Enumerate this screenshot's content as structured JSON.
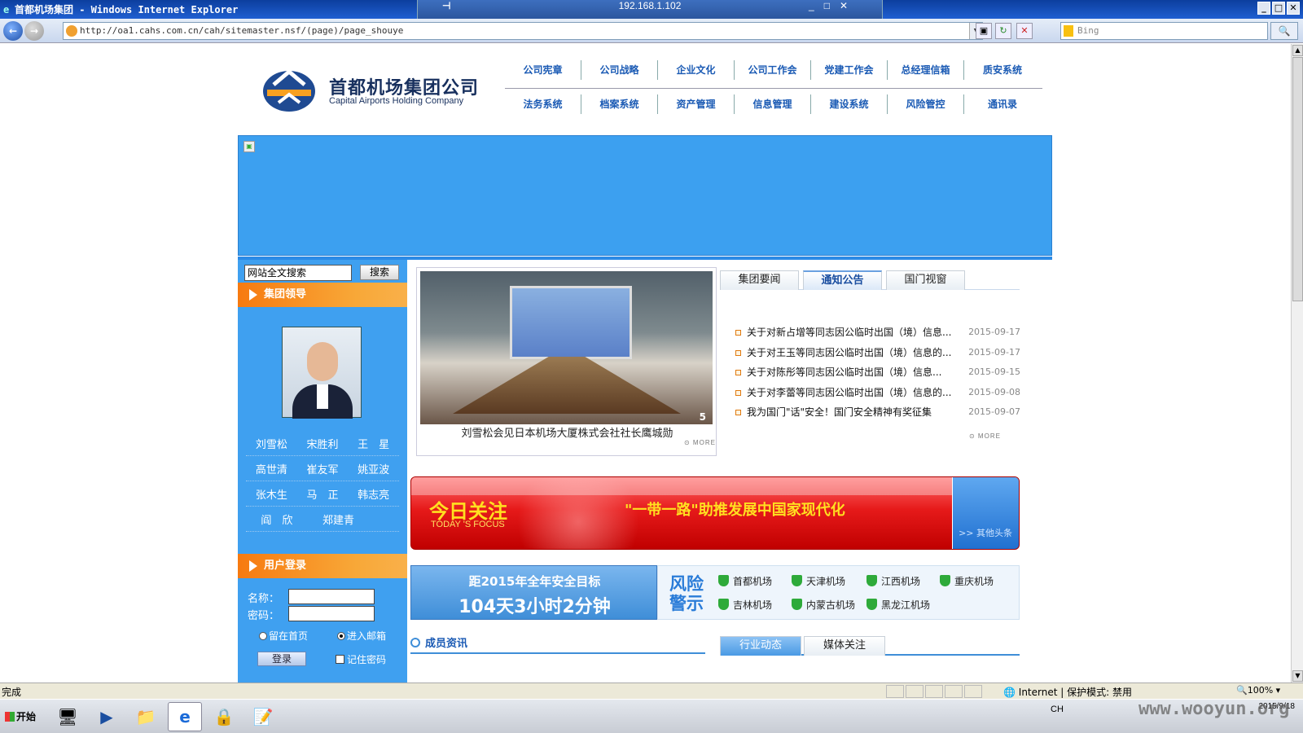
{
  "window": {
    "title": "首都机场集团 - Windows Internet Explorer",
    "rdp_host": "192.168.1.102",
    "min": "_",
    "max": "□",
    "close": "✕"
  },
  "browser": {
    "back": "←",
    "forward": "→",
    "address": "http://oa1.cahs.com.cn/cah/sitemaster.nsf/(page)/page_shouye",
    "search_placeholder": "Bing",
    "search_btn": "🔍",
    "refresh": "↻",
    "stop": "✕",
    "compat": "▣"
  },
  "site": {
    "logo_cn": "首都机场集团公司",
    "logo_en": "Capital Airports Holding Company",
    "nav_row1": [
      "公司宪章",
      "公司战略",
      "企业文化",
      "公司工作会",
      "党建工作会",
      "总经理信箱",
      "质安系统"
    ],
    "nav_row2": [
      "法务系统",
      "档案系统",
      "资产管理",
      "信息管理",
      "建设系统",
      "风险管控",
      "通讯录"
    ]
  },
  "left": {
    "search_placeholder": "网站全文搜索",
    "search_btn": "搜索",
    "leaders_title": "集团领导",
    "leaders": [
      [
        "刘雪松",
        "宋胜利",
        "王　星"
      ],
      [
        "高世清",
        "崔友军",
        "姚亚波"
      ],
      [
        "张木生",
        "马　正",
        "韩志亮"
      ],
      [
        "阎　欣",
        "郑建青",
        ""
      ]
    ],
    "login_title": "用户登录",
    "name_label": "名称：",
    "pwd_label": "密码：",
    "radio1": "留在首页",
    "radio2": "进入邮箱",
    "login_btn": "登录",
    "remember": "记住密码"
  },
  "photo": {
    "caption": "刘雪松会见日本机场大厦株式会社社长鹰城勋",
    "slide_num": "5",
    "more": "⊙ MORE"
  },
  "news": {
    "tabs": [
      "集团要闻",
      "通知公告",
      "国门视窗"
    ],
    "active_tab": "通知公告",
    "items": [
      {
        "title": "关于对新占增等同志因公临时出国（境）信息...",
        "date": "2015-09-17"
      },
      {
        "title": "关于对王玉等同志因公临时出国（境）信息的...",
        "date": "2015-09-17"
      },
      {
        "title": "关于对陈彤等同志因公临时出国（境）信息...",
        "date": "2015-09-15"
      },
      {
        "title": "关于对李蕾等同志因公临时出国（境）信息的...",
        "date": "2015-09-08"
      },
      {
        "title": "我为国门\"话\"安全！国门安全精神有奖征集",
        "date": "2015-09-07"
      }
    ],
    "more": "⊙ MORE"
  },
  "focus": {
    "title": "今日关注",
    "subtitle": "TODAY 'S FOCUS",
    "headline": "\"一带一路\"助推发展中国家现代化",
    "other": ">> 其他头条"
  },
  "countdown": {
    "line1": "距2015年全年安全目标",
    "line2": "104天3小时2分钟"
  },
  "risk": {
    "title": "风险警示",
    "airports": [
      "首都机场",
      "天津机场",
      "江西机场",
      "重庆机场",
      "吉林机场",
      "内蒙古机场",
      "黑龙江机场"
    ]
  },
  "bottom": {
    "member_title": "成员资讯",
    "tabs": [
      "行业动态",
      "媒体关注"
    ],
    "active_tab": "行业动态"
  },
  "status": {
    "text": "完成",
    "zone": "Internet | 保护模式: 禁用",
    "zoom": "100%"
  },
  "taskbar": {
    "start": "开始",
    "lang": "CH",
    "time": "2015/9/18"
  },
  "watermark": "www.wooyun.org"
}
